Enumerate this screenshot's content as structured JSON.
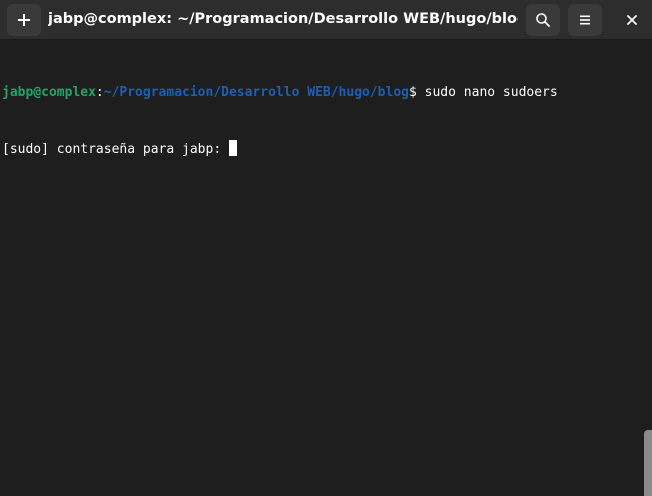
{
  "window": {
    "title": "jabp@complex: ~/Programacion/Desarrollo WEB/hugo/blog"
  },
  "headerbar": {
    "new_tab_icon": "plus-icon",
    "search_icon": "search-icon",
    "menu_icon": "hamburger-menu-icon",
    "close_icon": "close-icon"
  },
  "terminal": {
    "prompt": {
      "user_host": "jabp@complex",
      "separator": ":",
      "path": "~/Programacion/Desarrollo WEB/hugo/blog",
      "symbol": "$",
      "command": " sudo nano sudoers"
    },
    "password_prompt": "[sudo] contraseña para jabp: "
  },
  "colors": {
    "background": "#1e1e1e",
    "headerbar": "#2d2d2d",
    "user_host": "#26a269",
    "path": "#1c5fb3",
    "text": "#ffffff"
  }
}
